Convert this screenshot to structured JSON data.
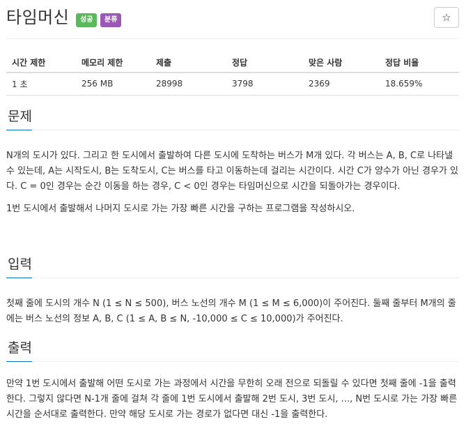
{
  "problem": {
    "title": "타임머신",
    "badges": {
      "success": "성공",
      "category": "분류"
    },
    "star_symbol": "☆"
  },
  "stats": {
    "headers": [
      "시간 제한",
      "메모리 제한",
      "제출",
      "정답",
      "맞은 사람",
      "정답 비율"
    ],
    "values": [
      "1 초",
      "256 MB",
      "28998",
      "3798",
      "2369",
      "18.659%"
    ]
  },
  "sections": {
    "description": {
      "title": "문제",
      "paragraphs": [
        "N개의 도시가 있다. 그리고 한 도시에서 출발하여 다른 도시에 도착하는 버스가 M개 있다. 각 버스는 A, B, C로 나타낼 수 있는데, A는 시작도시, B는 도착도시, C는 버스를 타고 이동하는데 걸리는 시간이다. 시간 C가 양수가 아닌 경우가 있다. C = 0인 경우는 순간 이동을 하는 경우, C < 0인 경우는 타임머신으로 시간을 되돌아가는 경우이다.",
        "1번 도시에서 출발해서 나머지 도시로 가는 가장 빠른 시간을 구하는 프로그램을 작성하시오."
      ]
    },
    "input": {
      "title": "입력",
      "paragraphs": [
        "첫째 줄에 도시의 개수 N (1 ≤ N ≤ 500), 버스 노선의 개수 M (1 ≤ M ≤ 6,000)이 주어진다. 둘째 줄부터 M개의 줄에는 버스 노선의 정보 A, B, C (1 ≤ A, B ≤ N, -10,000 ≤ C ≤ 10,000)가 주어진다."
      ]
    },
    "output": {
      "title": "출력",
      "paragraphs": [
        "만약 1번 도시에서 출발해 어떤 도시로 가는 과정에서 시간을 무한히 오래 전으로 되돌릴 수 있다면 첫째 줄에 -1을 출력한다. 그렇지 않다면 N-1개 줄에 걸쳐 각 줄에 1번 도시에서 출발해 2번 도시, 3번 도시, ..., N번 도시로 가는 가장 빠른 시간을 순서대로 출력한다. 만약 해당 도시로 가는 경로가 없다면 대신 -1을 출력한다."
      ]
    }
  }
}
